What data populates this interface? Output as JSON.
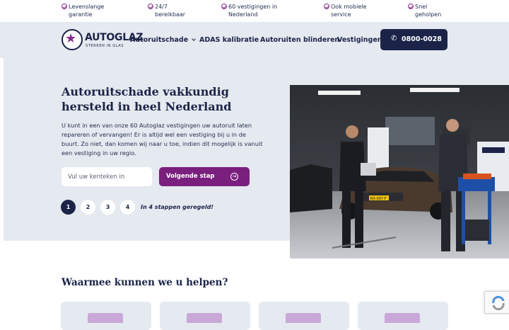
{
  "usp": [
    {
      "label": "Levenslange garantie",
      "line1": "Levenslange",
      "line2": "garantie"
    },
    {
      "label": "24/7 bereikbaar",
      "line1": "24/7",
      "line2": "bereikbaar"
    },
    {
      "label": "60 vestigingen in Nederland",
      "line1": "60 vestigingen in",
      "line2": "Nederland"
    },
    {
      "label": "Ook mobiele service",
      "line1": "Ook mobiele",
      "line2": "service"
    },
    {
      "label": "Snel geholpen",
      "line1": "Snel",
      "line2": "geholpen"
    }
  ],
  "logo": {
    "word": "AUTOGLAZ",
    "tagline": "STERREN IN GLAS"
  },
  "nav": {
    "items": [
      "Autoruitschade",
      "ADAS kalibratie",
      "Autoruiten blinderen",
      "Vestigingen"
    ],
    "phone": "0800-0028"
  },
  "hero": {
    "title": "Autoruitschade vakkundig hersteld in heel Nederland",
    "text": "U kunt in een van onze 60 Autoglaz vestigingen uw autoruit laten repareren of vervangen! Er is altijd wel een vestiging bij u in de buurt. Zo niet, dan komen wij naar u toe, indien dit mogelijk is vanuit een vestiging in uw regio.",
    "input_placeholder": "Vul uw kenteken in",
    "button": "Volgende stap",
    "steps": [
      "1",
      "2",
      "3",
      "4"
    ],
    "steps_note": "In 4 stappen geregeld!",
    "plate": "RX-097-F"
  },
  "services": {
    "title": "Waarmee kunnen we u helpen?"
  },
  "colors": {
    "navy": "#1b2448",
    "purple": "#7a1f7e",
    "light": "#e5e9f0"
  },
  "icons": {
    "usp": "check-circle-icon",
    "phone": "phone-icon",
    "next": "arrow-right-circle-icon",
    "nav_dropdown": "chevron-down-icon"
  }
}
